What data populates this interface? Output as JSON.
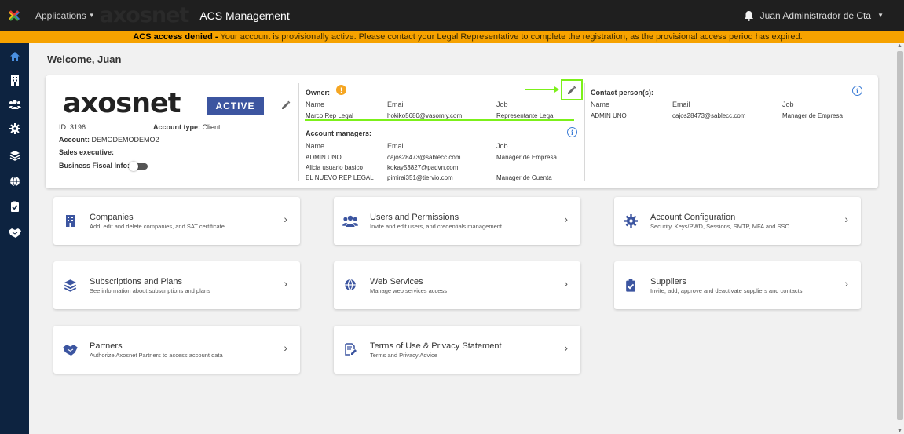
{
  "topbar": {
    "applications_label": "Applications",
    "watermark_text": "axosnet",
    "app_title": "ACS Management",
    "user_name": "Juan Administrador de Cta"
  },
  "banner": {
    "bold_text": "ACS access denied -",
    "message": " Your account is provisionally active. Please contact your Legal Representative to complete the registration, as the provisional access period has expired."
  },
  "sidebar": {
    "items": [
      "home-icon",
      "building-icon",
      "users-icon",
      "gear-icon",
      "layers-icon",
      "globe-icon",
      "clipboard-check-icon",
      "handshake-icon"
    ]
  },
  "welcome": "Welcome, Juan",
  "account": {
    "brand": "axosnet",
    "status": "ACTIVE",
    "id_label": "ID:",
    "id_value": "3196",
    "type_label": "Account type:",
    "type_value": "Client",
    "account_label": "Account:",
    "account_value": "DEMODEMODEMO2",
    "sales_label": "Sales executive:",
    "fiscal_label": "Business Fiscal Info:"
  },
  "owner": {
    "label": "Owner:",
    "headers": [
      "Name",
      "Email",
      "Job"
    ],
    "row": [
      "Marco Rep Legal",
      "hokiko5680@vasomly.com",
      "Representante Legal"
    ]
  },
  "managers": {
    "label": "Account managers:",
    "headers": [
      "Name",
      "Email",
      "Job"
    ],
    "rows": [
      [
        "ADMIN UNO",
        "cajos28473@sablecc.com",
        "Manager de Empresa"
      ],
      [
        "Alicia usuario basico",
        "kokay53827@padvn.com",
        ""
      ],
      [
        "EL NUEVO REP LEGAL",
        "pimirai351@tiervio.com",
        "Manager de Cuenta"
      ]
    ]
  },
  "contacts": {
    "label": "Contact person(s):",
    "headers": [
      "Name",
      "Email",
      "Job"
    ],
    "row": [
      "ADMIN UNO",
      "cajos28473@sablecc.com",
      "Manager de Empresa"
    ]
  },
  "tiles": [
    {
      "title": "Companies",
      "desc": "Add, edit and delete companies, and SAT certificate",
      "icon": "building-icon"
    },
    {
      "title": "Users and Permissions",
      "desc": "Invite and edit users, and credentials management",
      "icon": "users-icon"
    },
    {
      "title": "Account Configuration",
      "desc": "Security, Keys/PWD, Sessions, SMTP, MFA and SSO",
      "icon": "gear-icon"
    },
    {
      "title": "Subscriptions and Plans",
      "desc": "See information about subscriptions and plans",
      "icon": "layers-icon"
    },
    {
      "title": "Web Services",
      "desc": "Manage web services access",
      "icon": "globe-icon"
    },
    {
      "title": "Suppliers",
      "desc": "Invite, add, approve and deactivate suppliers and contacts",
      "icon": "clipboard-check-icon"
    },
    {
      "title": "Partners",
      "desc": "Authorize Axosnet Partners to access account data",
      "icon": "handshake-icon"
    },
    {
      "title": "Terms of Use & Privacy Statement",
      "desc": "Terms and Privacy Advice",
      "icon": "document-edit-icon"
    }
  ],
  "colors": {
    "topbar": "#1f1f1f",
    "banner": "#f6a200",
    "sidebar": "#0d2340",
    "active_badge": "#3c55a0",
    "icon_blue": "#3c55a0",
    "highlight": "#7cf01a"
  }
}
